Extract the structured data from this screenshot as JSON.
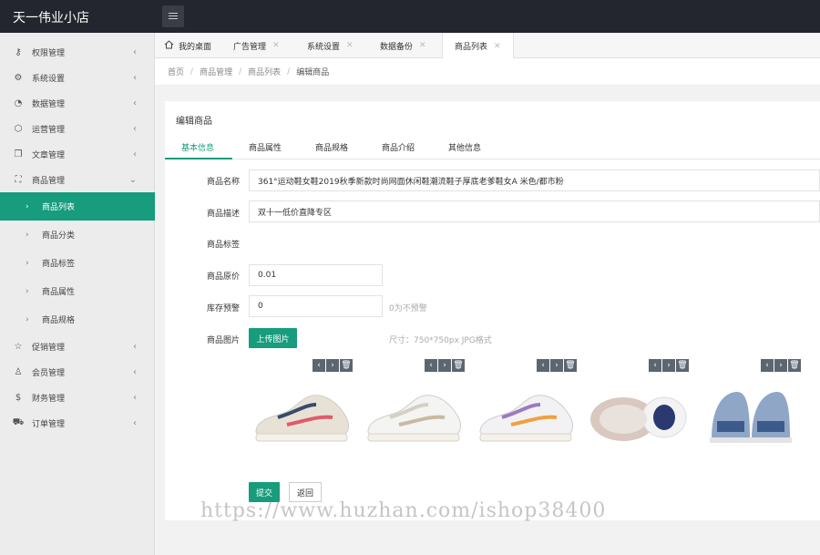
{
  "app": {
    "title": "天一伟业小店"
  },
  "sidebar": {
    "items": [
      {
        "label": "权限管理",
        "icon": "key-icon",
        "glyph": "⚷",
        "arrow": "‹"
      },
      {
        "label": "系统设置",
        "icon": "gear-icon",
        "glyph": "⚙",
        "arrow": "‹"
      },
      {
        "label": "数据管理",
        "icon": "data-icon",
        "glyph": "◔",
        "arrow": "‹"
      },
      {
        "label": "运营管理",
        "icon": "hexagon-icon",
        "glyph": "⬡",
        "arrow": "‹"
      },
      {
        "label": "文章管理",
        "icon": "book-icon",
        "glyph": "❒",
        "arrow": "‹"
      },
      {
        "label": "商品管理",
        "icon": "bag-icon",
        "glyph": "⛶",
        "arrow": "⌄"
      }
    ],
    "subitems": [
      {
        "label": "商品列表"
      },
      {
        "label": "商品分类"
      },
      {
        "label": "商品标签"
      },
      {
        "label": "商品属性"
      },
      {
        "label": "商品规格"
      }
    ],
    "items_after": [
      {
        "label": "促销管理",
        "icon": "star-icon",
        "glyph": "☆",
        "arrow": "‹"
      },
      {
        "label": "会员管理",
        "icon": "user-icon",
        "glyph": "♙",
        "arrow": "‹"
      },
      {
        "label": "财务管理",
        "icon": "dollar-icon",
        "glyph": "$",
        "arrow": "‹"
      },
      {
        "label": "订单管理",
        "icon": "cart-icon",
        "glyph": "⛟",
        "arrow": "‹"
      }
    ],
    "sub_arrow": "›"
  },
  "tabs": [
    {
      "label": "我的桌面",
      "icon": "home-icon"
    },
    {
      "label": "广告管理",
      "close": "✕"
    },
    {
      "label": "系统设置",
      "close": "✕"
    },
    {
      "label": "数据备份",
      "close": "✕"
    },
    {
      "label": "商品列表",
      "close": "✕"
    }
  ],
  "breadcrumb": [
    "首页",
    "商品管理",
    "商品列表",
    "编辑商品"
  ],
  "breadcrumb_sep": "/",
  "form": {
    "title": "编辑商品",
    "tabs": [
      "基本信息",
      "商品属性",
      "商品规格",
      "商品介绍",
      "其他信息"
    ],
    "name_label": "商品名称",
    "name_value": "361°运动鞋女鞋2019秋季新款时尚网面休闲鞋潮流鞋子厚底老爹鞋女A 米色/都市粉",
    "desc_label": "商品描述",
    "desc_value": "双十一低价直降专区",
    "tags_label": "商品标签",
    "price_label": "商品原价",
    "price_value": "0.01",
    "stock_label": "库存预警",
    "stock_value": "0",
    "stock_hint": "0为不预警",
    "image_label": "商品图片",
    "upload_label": "上传图片",
    "size_hint": "尺寸：750*750px JPG格式",
    "submit_label": "提交",
    "back_label": "返回"
  },
  "image_controls": {
    "left": "‹",
    "right": "›",
    "delete": "🗑"
  },
  "images": [
    {
      "accent": "#e05a6a",
      "body": "#e8e2d6",
      "trim": "#3a4a6b"
    },
    {
      "accent": "#c9b9a0",
      "body": "#f4f4f2",
      "trim": "#d6d0c4"
    },
    {
      "accent": "#f0a040",
      "body": "#f2f2f4",
      "trim": "#9a7cc0"
    },
    {
      "accent": "#2a3a70",
      "body": "#e9e2dc",
      "trim": "#d8c8c0"
    },
    {
      "accent": "#3d5a8c",
      "body": "#8fa6c6",
      "trim": "#e4e4e4"
    }
  ],
  "watermark": "https://www.huzhan.com/ishop38400",
  "colors": {
    "accent": "#179c7d",
    "topbar": "#23262e"
  }
}
